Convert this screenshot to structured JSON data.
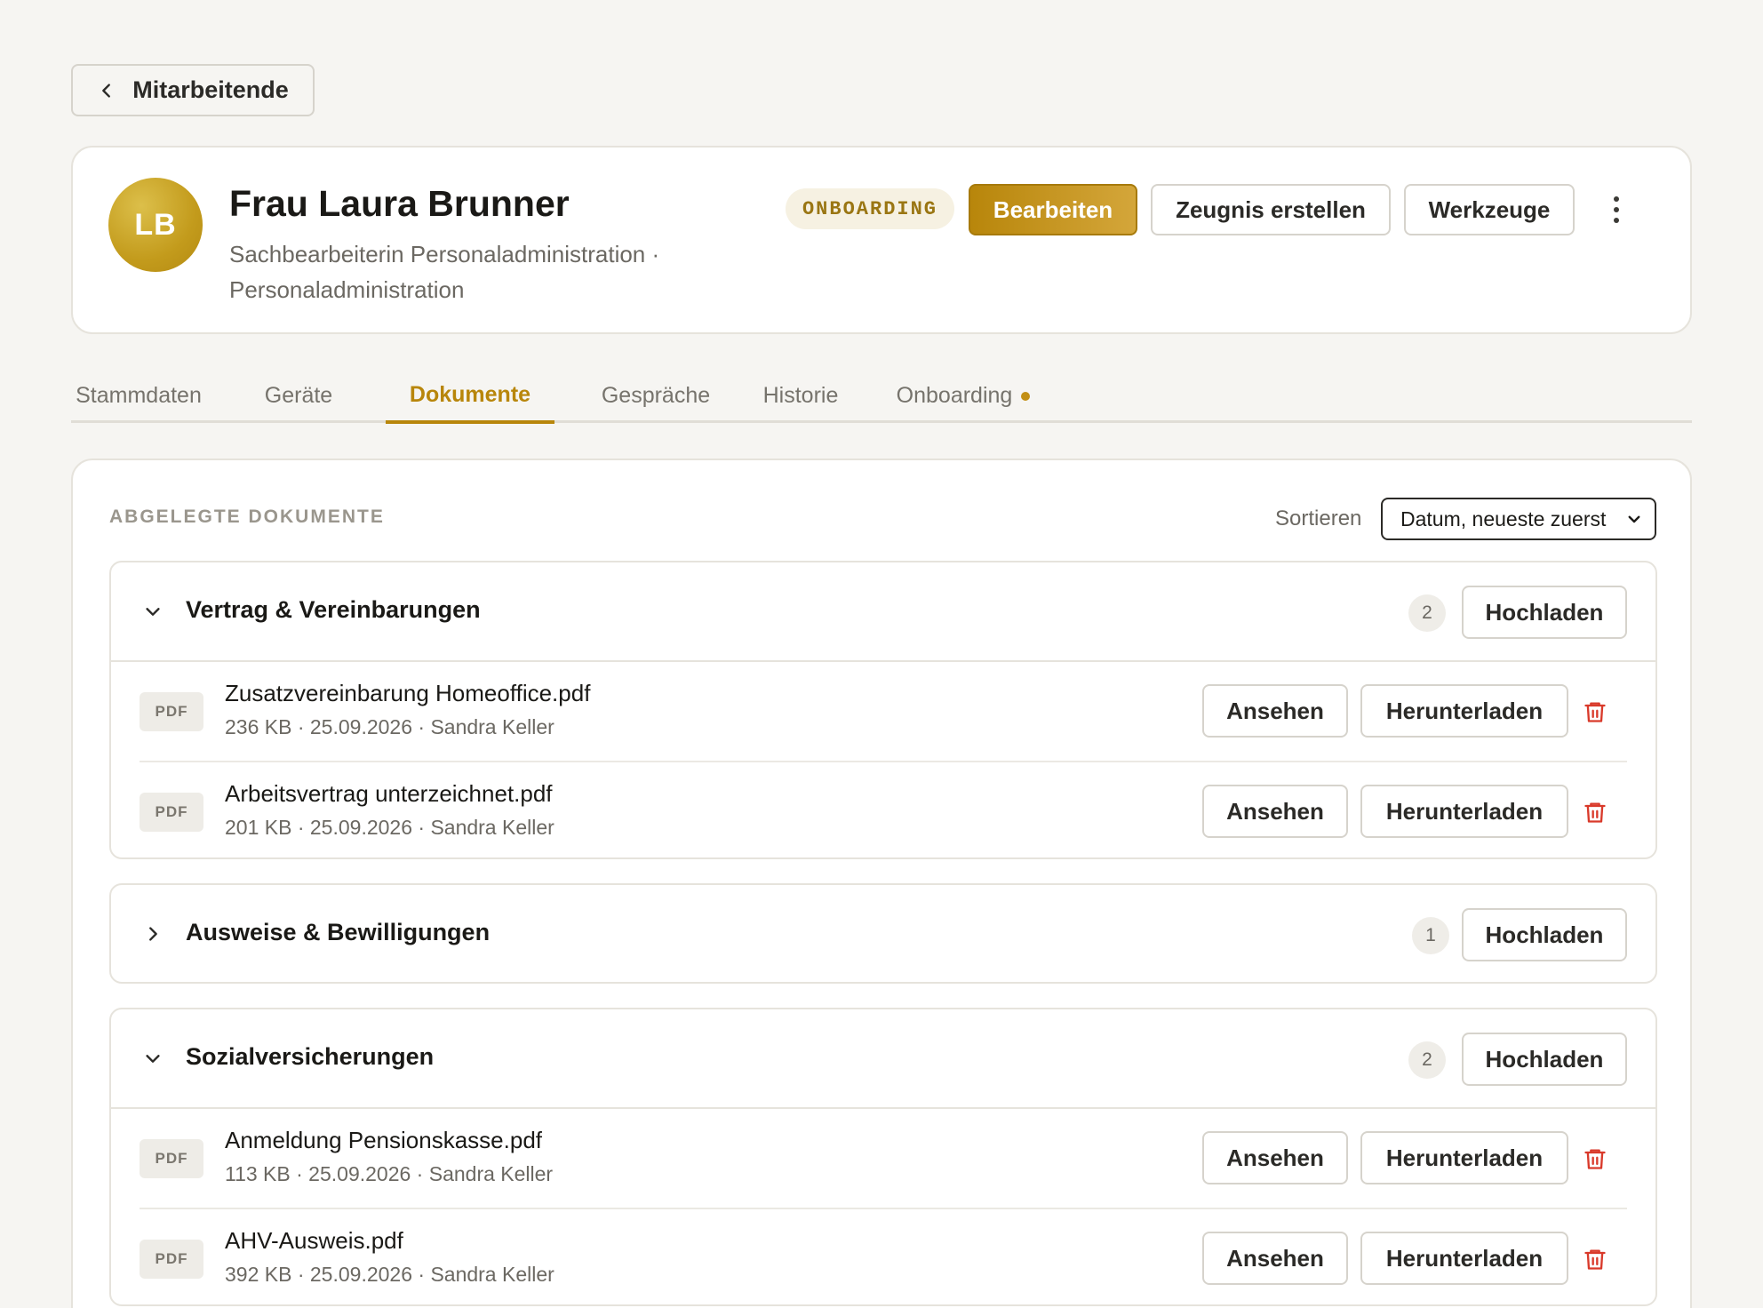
{
  "nav": {
    "back_label": "Mitarbeitende"
  },
  "employee": {
    "initials": "LB",
    "name": "Frau Laura Brunner",
    "role": "Sachbearbeiterin Personaladministration · Personaladministration",
    "status": "ONBOARDING"
  },
  "actions": {
    "edit": "Bearbeiten",
    "certificate": "Zeugnis erstellen",
    "tools": "Werkzeuge"
  },
  "tabs": [
    {
      "label": "Stammdaten",
      "active": false
    },
    {
      "label": "Geräte",
      "active": false
    },
    {
      "label": "Dokumente",
      "active": true
    },
    {
      "label": "Gespräche",
      "active": false
    },
    {
      "label": "Historie",
      "active": false
    },
    {
      "label": "Onboarding",
      "active": false,
      "indicator": true
    }
  ],
  "documents": {
    "section_title": "ABGELEGTE DOKUMENTE",
    "sort_label": "Sortieren",
    "sort_value": "Datum, neueste zuerst",
    "upload_label": "Hochladen",
    "view_label": "Ansehen",
    "download_label": "Herunterladen",
    "file_type": "PDF",
    "groups": [
      {
        "name": "Vertrag & Vereinbarungen",
        "count": "2",
        "expanded": true,
        "files": [
          {
            "name": "Zusatzvereinbarung Homeoffice.pdf",
            "meta": "236 KB · 25.09.2026 · Sandra Keller"
          },
          {
            "name": "Arbeitsvertrag unterzeichnet.pdf",
            "meta": "201 KB · 25.09.2026 · Sandra Keller"
          }
        ]
      },
      {
        "name": "Ausweise & Bewilligungen",
        "count": "1",
        "expanded": false,
        "files": []
      },
      {
        "name": "Sozialversicherungen",
        "count": "2",
        "expanded": true,
        "files": [
          {
            "name": "Anmeldung Pensionskasse.pdf",
            "meta": "113 KB · 25.09.2026 · Sandra Keller"
          },
          {
            "name": "AHV-Ausweis.pdf",
            "meta": "392 KB · 25.09.2026 · Sandra Keller"
          }
        ]
      }
    ]
  },
  "colors": {
    "accent": "#b8860b",
    "danger": "#d93a2b",
    "background": "#f6f5f2"
  }
}
